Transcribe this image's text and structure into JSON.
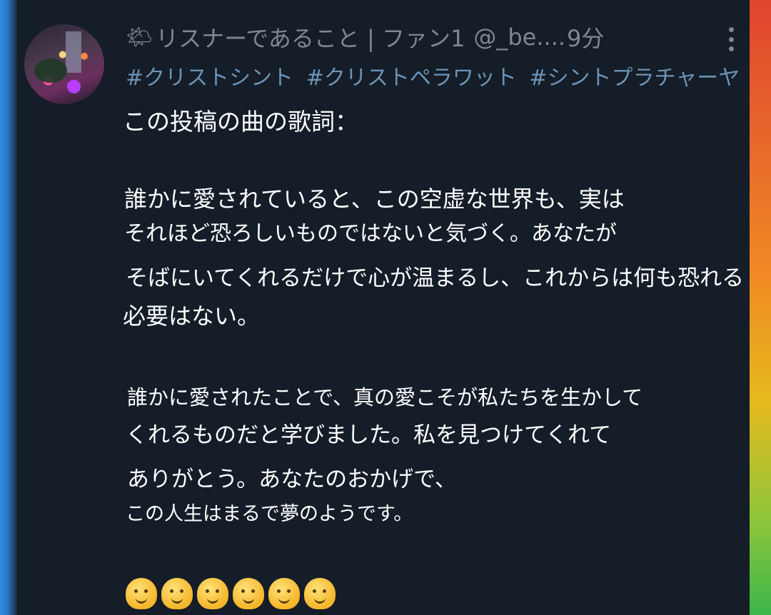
{
  "post": {
    "display_name": "リスナーであること | ファン1",
    "separator": "|",
    "handle": "@_be....",
    "time": "9分",
    "hashtags": [
      "#クリストシント",
      "#クリストペラワット",
      "#シントプラチャーヤ"
    ],
    "lines": [
      "この投稿の曲の歌詞：",
      "誰かに愛されていると、この空虚な世界も、実は",
      "それほど恐ろしいものではないと気づく。あなたが",
      "そばにいてくれるだけで心が温まるし、これからは何も恐れる",
      "必要はない。",
      "誰かに愛されたことで、真の愛こそが私たちを生かして",
      "くれるものだと学びました。私を見つけてくれて",
      "ありがとう。あなたのおかげで、",
      "この人生はまるで夢のようです。"
    ],
    "emoji_names": [
      "hugging-face-icon",
      "hugging-face-icon",
      "hugging-face-icon",
      "hugging-face-icon",
      "hugging-face-icon",
      "hugging-face-icon"
    ]
  },
  "colors": {
    "background": "#141d28",
    "header_text": "#7d8894",
    "hashtag": "#6d93b6",
    "body_text": "#ffffff"
  },
  "icons": {
    "weather": "sun-behind-cloud-icon",
    "more": "more-vertical-icon"
  }
}
